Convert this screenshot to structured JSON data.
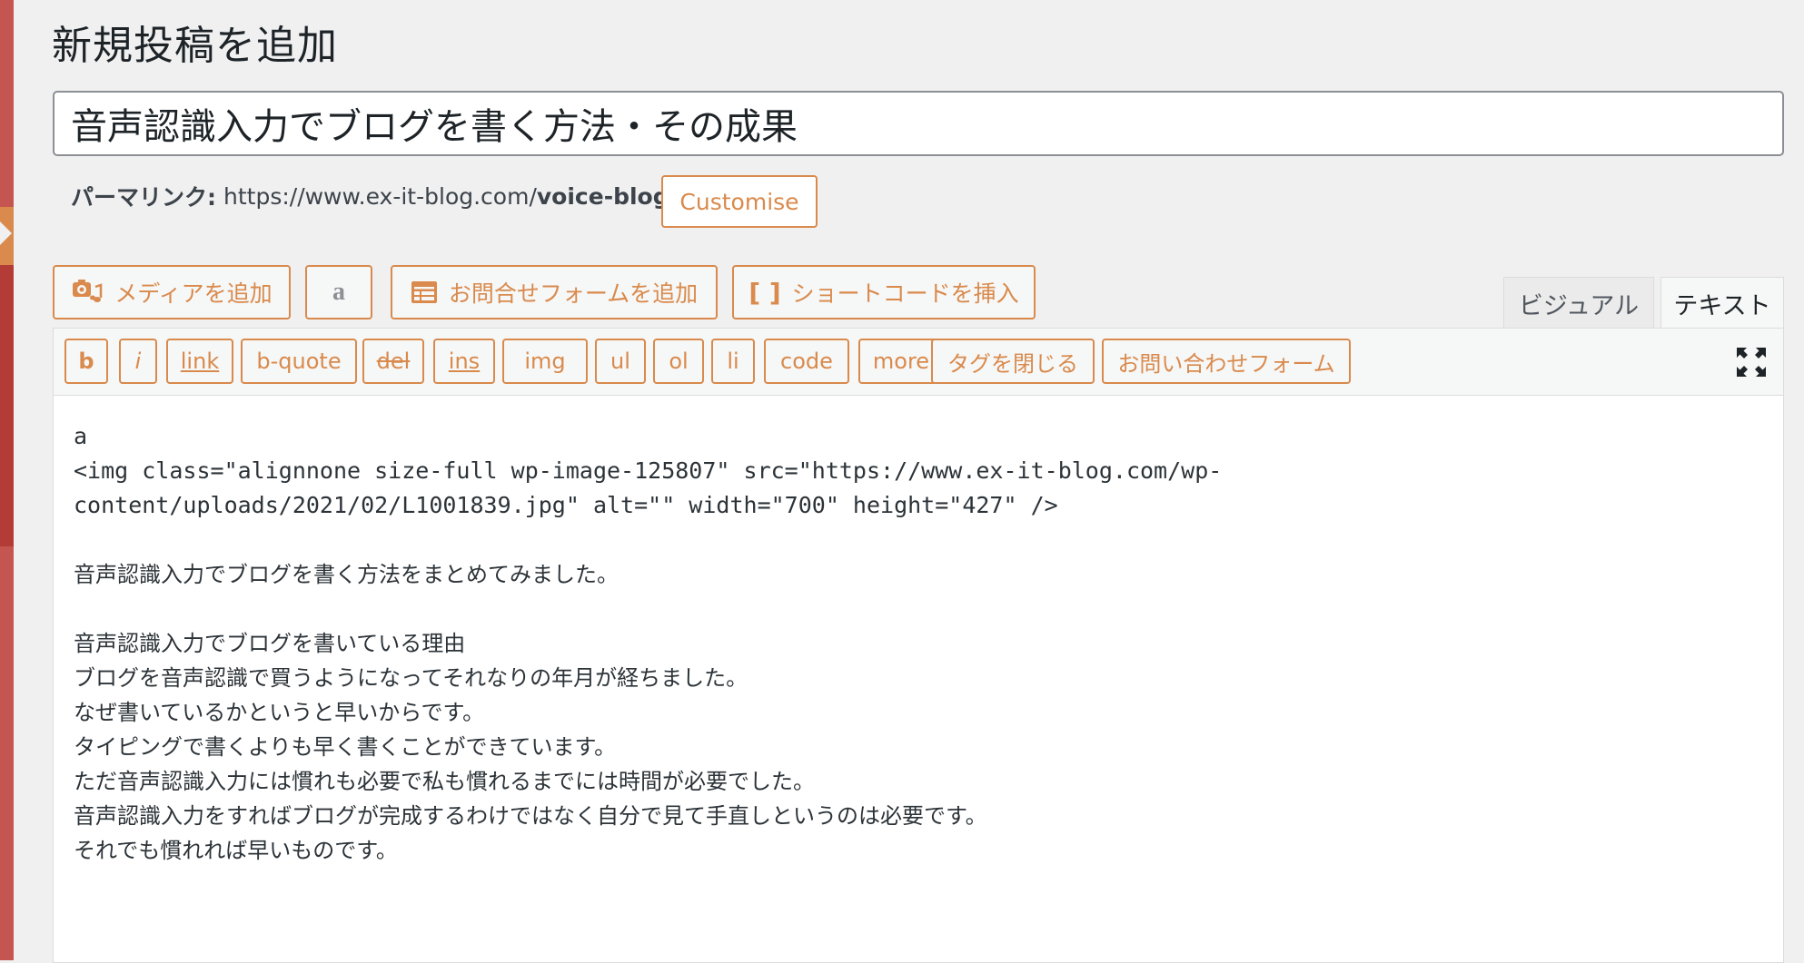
{
  "page_title": "新規投稿を追加",
  "post_title": "音声認識入力でブログを書く方法・その成果",
  "permalink": {
    "label": "パーマリンク:",
    "base_url": "https://www.ex-it-blog.com/",
    "slug": "voice-blog",
    "customise_label": "Customise"
  },
  "media_buttons": {
    "add_media": "メディアを追加",
    "amazon": "a",
    "add_contact_form": "お問合せフォームを追加",
    "insert_shortcode": "ショートコードを挿入"
  },
  "editor_tabs": {
    "visual": "ビジュアル",
    "text": "テキスト",
    "active": "text"
  },
  "quicktags": [
    "b",
    "i",
    "link",
    "b-quote",
    "del",
    "ins",
    "img",
    "ul",
    "ol",
    "li",
    "code",
    "more",
    "タグを閉じる",
    "お問い合わせフォーム"
  ],
  "content": {
    "line1": "a",
    "line2": "<img class=\"alignnone size-full wp-image-125807\" src=\"https://www.ex-it-blog.com/wp-",
    "line3": "content/uploads/2021/02/L1001839.jpg\" alt=\"\" width=\"700\" height=\"427\" />",
    "line5": "音声認識入力でブログを書く方法をまとめてみました。",
    "line7": "音声認識入力でブログを書いている理由",
    "line8": "ブログを音声認識で買うようになってそれなりの年月が経ちました。",
    "line9": "なぜ書いているかというと早いからです。",
    "line10": "タイピングで書くよりも早く書くことができています。",
    "line11": "ただ音声認識入力には慣れも必要で私も慣れるまでには時間が必要でした。",
    "line12": "音声認識入力をすればブログが完成するわけではなく自分で見て手直しというのは必要です。",
    "line13": "それでも慣れれば早いものです。"
  },
  "colors": {
    "accent": "#d98a4c",
    "admin_bar": "#c55550"
  }
}
